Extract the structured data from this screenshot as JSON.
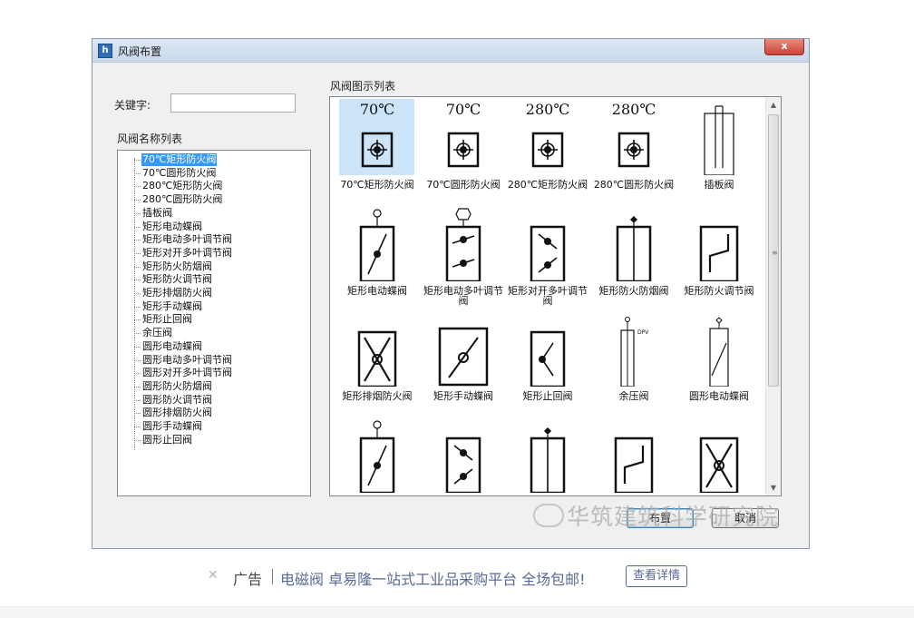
{
  "window": {
    "title": "风阀布置",
    "close_label": "x"
  },
  "keyword": {
    "label": "关键字:",
    "value": ""
  },
  "name_list": {
    "title": "风阀名称列表",
    "items": [
      "70℃矩形防火阀",
      "70℃圆形防火阀",
      "280℃矩形防火阀",
      "280℃圆形防火阀",
      "插板阀",
      "矩形电动蝶阀",
      "矩形电动多叶调节阀",
      "矩形对开多叶调节阀",
      "矩形防火防烟阀",
      "矩形防火调节阀",
      "矩形排烟防火阀",
      "矩形手动蝶阀",
      "矩形止回阀",
      "余压阀",
      "圆形电动蝶阀",
      "圆形电动多叶调节阀",
      "圆形对开多叶调节阀",
      "圆形防火防烟阀",
      "圆形防火调节阀",
      "圆形排烟防火阀",
      "圆形手动蝶阀",
      "圆形止回阀"
    ],
    "selected_index": 0
  },
  "icon_list": {
    "title": "风阀图示列表",
    "cells": [
      {
        "temp": "70℃",
        "label": "70℃矩形防火阀",
        "icon": "rect-fire-valve-icon"
      },
      {
        "temp": "70℃",
        "label": "70℃圆形防火阀",
        "icon": "round-fire-valve-icon"
      },
      {
        "temp": "280℃",
        "label": "280℃矩形防火阀",
        "icon": "rect-fire-valve-icon"
      },
      {
        "temp": "280℃",
        "label": "280℃圆形防火阀",
        "icon": "round-fire-valve-icon"
      },
      {
        "temp": "",
        "label": "插板阀",
        "icon": "slide-gate-valve-icon"
      },
      {
        "temp": "",
        "label": "矩形电动蝶阀",
        "icon": "rect-electric-butterfly-valve-icon"
      },
      {
        "temp": "",
        "label": "矩形电动多叶调节阀",
        "icon": "rect-electric-multi-blade-valve-icon"
      },
      {
        "temp": "",
        "label": "矩形对开多叶调节阀",
        "icon": "rect-opposed-blade-valve-icon"
      },
      {
        "temp": "",
        "label": "矩形防火防烟阀",
        "icon": "rect-fire-smoke-valve-icon"
      },
      {
        "temp": "",
        "label": "矩形防火调节阀",
        "icon": "rect-fire-regulating-valve-icon"
      },
      {
        "temp": "",
        "label": "矩形排烟防火阀",
        "icon": "rect-smoke-exhaust-valve-icon"
      },
      {
        "temp": "",
        "label": "矩形手动蝶阀",
        "icon": "rect-manual-butterfly-valve-icon"
      },
      {
        "temp": "",
        "label": "矩形止回阀",
        "icon": "rect-check-valve-icon"
      },
      {
        "temp": "",
        "label": "余压阀",
        "icon": "pressure-relief-valve-icon"
      },
      {
        "temp": "",
        "label": "圆形电动蝶阀",
        "icon": "round-electric-butterfly-valve-icon"
      },
      {
        "temp": "",
        "label": "",
        "icon": "round-electric-multi-blade-valve-icon"
      },
      {
        "temp": "",
        "label": "",
        "icon": "round-opposed-blade-valve-icon"
      },
      {
        "temp": "",
        "label": "",
        "icon": "round-fire-smoke-valve-icon"
      },
      {
        "temp": "",
        "label": "",
        "icon": "round-fire-regulating-valve-icon"
      },
      {
        "temp": "",
        "label": "",
        "icon": "round-smoke-exhaust-valve-icon"
      }
    ],
    "selected_index": 0,
    "dpv_text": "DPV"
  },
  "buttons": {
    "place": "布置",
    "cancel": "取消"
  },
  "watermark": "华筑建筑科学研究院",
  "ad": {
    "close_glyph": "✕",
    "tag": "广告",
    "text": "电磁阀 卓易隆一站式工业品采购平台 全场包邮!",
    "button": "查看详情"
  }
}
